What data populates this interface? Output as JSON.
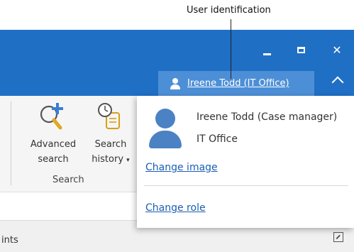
{
  "annotation": {
    "label": "User identification"
  },
  "window": {
    "minimize_glyph": "minimize-icon",
    "maximize_glyph": "maximize-icon",
    "close_label": "✕"
  },
  "user_button": {
    "name": "Ireene Todd (IT Office)",
    "icon": "user-icon"
  },
  "ribbon": {
    "advanced_search": {
      "line1": "Advanced",
      "line2": "search",
      "icon": "search-add-icon"
    },
    "search_history": {
      "line1": "Search",
      "line2": "history",
      "icon": "history-scroll-icon"
    },
    "group_label": "Search"
  },
  "status": {
    "partial_text": "ints"
  },
  "popup": {
    "name_role": "Ireene Todd (Case manager)",
    "office": "IT Office",
    "change_image": "Change image",
    "change_role": "Change role",
    "avatar": "avatar-icon"
  },
  "colors": {
    "titlebar": "#1f6fc5",
    "user_button": "#4d8fd6",
    "link": "#1a5fb4",
    "avatar": "#4a82c4"
  }
}
